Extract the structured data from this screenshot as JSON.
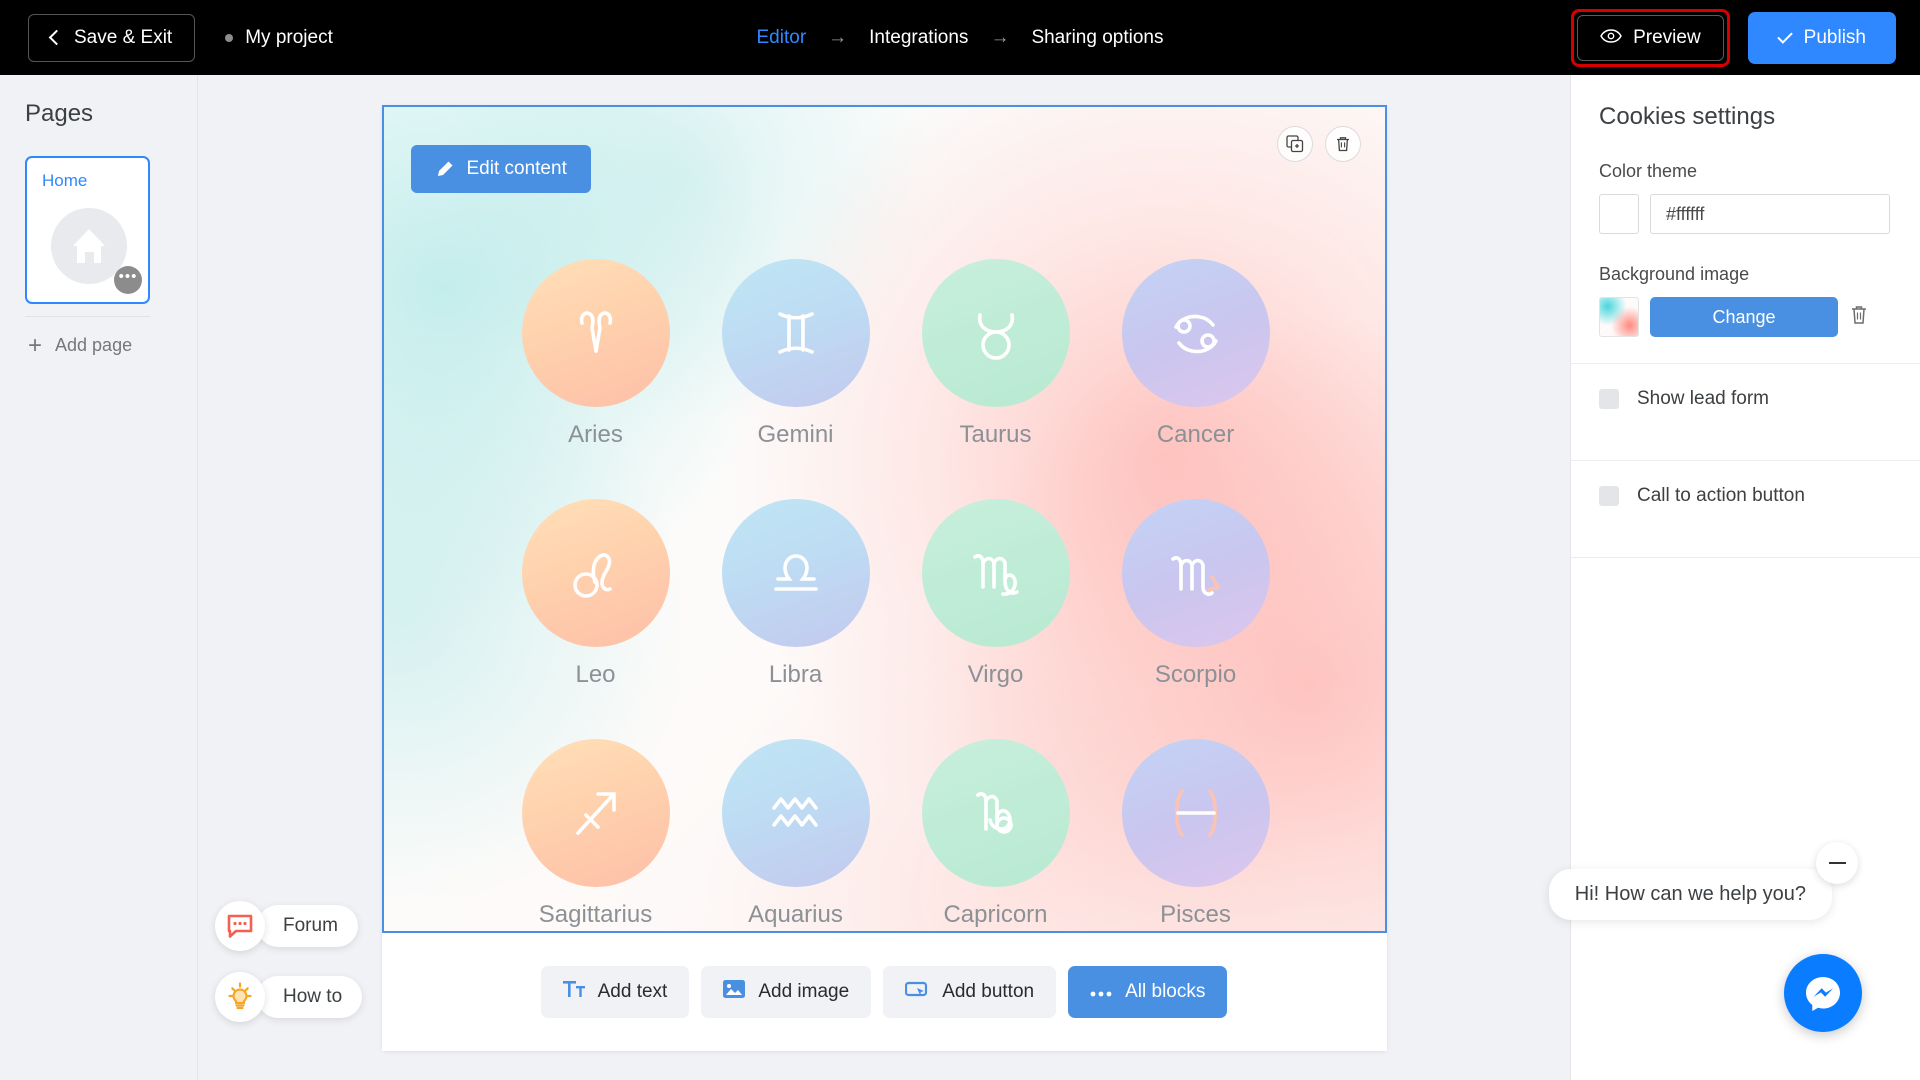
{
  "topbar": {
    "save_exit": "Save & Exit",
    "project_name": "My project",
    "nav": [
      {
        "label": "Editor",
        "active": true
      },
      {
        "label": "Integrations",
        "active": false
      },
      {
        "label": "Sharing options",
        "active": false
      }
    ],
    "arrow": "→",
    "preview": "Preview",
    "publish": "Publish",
    "highlight_color": "#d60000",
    "accent_color": "#2f88ff"
  },
  "sidebar": {
    "title": "Pages",
    "pages": [
      {
        "label": "Home",
        "icon": "home-icon",
        "selected": true
      }
    ],
    "page_menu_dots": "•••",
    "add_page": "Add page"
  },
  "canvas": {
    "edit_content": "Edit content",
    "tools": [
      {
        "name": "duplicate-icon"
      },
      {
        "name": "delete-icon"
      }
    ],
    "zodiac": [
      {
        "name": "Aries",
        "glyph": "aries-glyph",
        "color": "orange"
      },
      {
        "name": "Gemini",
        "glyph": "gemini-glyph",
        "color": "blue"
      },
      {
        "name": "Taurus",
        "glyph": "taurus-glyph",
        "color": "green"
      },
      {
        "name": "Cancer",
        "glyph": "cancer-glyph",
        "color": "lavender"
      },
      {
        "name": "Leo",
        "glyph": "leo-glyph",
        "color": "orange"
      },
      {
        "name": "Libra",
        "glyph": "libra-glyph",
        "color": "blue"
      },
      {
        "name": "Virgo",
        "glyph": "virgo-glyph",
        "color": "green"
      },
      {
        "name": "Scorpio",
        "glyph": "scorpio-glyph",
        "color": "lavender"
      },
      {
        "name": "Sagittarius",
        "glyph": "sagittarius-glyph",
        "color": "orange"
      },
      {
        "name": "Aquarius",
        "glyph": "aquarius-glyph",
        "color": "blue"
      },
      {
        "name": "Capricorn",
        "glyph": "capricorn-glyph",
        "color": "green"
      },
      {
        "name": "Pisces",
        "glyph": "pisces-glyph",
        "color": "lavender"
      }
    ],
    "add_buttons": [
      {
        "label": "Add text",
        "icon": "text-icon",
        "primary": false
      },
      {
        "label": "Add image",
        "icon": "image-icon",
        "primary": false
      },
      {
        "label": "Add button",
        "icon": "button-icon",
        "primary": false
      },
      {
        "label": "All blocks",
        "icon": "dots-icon",
        "primary": true
      }
    ]
  },
  "help": [
    {
      "label": "Forum",
      "icon": "chat-bubble-icon",
      "color": "#f4604f"
    },
    {
      "label": "How to",
      "icon": "lightbulb-icon",
      "color": "#f5a623"
    }
  ],
  "right_panel": {
    "title": "Cookies settings",
    "color_theme_label": "Color theme",
    "color_theme_value": "#ffffff",
    "background_image_label": "Background image",
    "change_button": "Change",
    "delete_icon": "trash-icon",
    "toggles": [
      {
        "label": "Show lead form",
        "checked": false
      },
      {
        "label": "Call to action button",
        "checked": false
      }
    ]
  },
  "chat": {
    "message": "Hi! How can we help you?",
    "minimize_icon": "minimize-icon",
    "fab_icon": "messenger-icon",
    "fab_color": "#0a7cff"
  }
}
